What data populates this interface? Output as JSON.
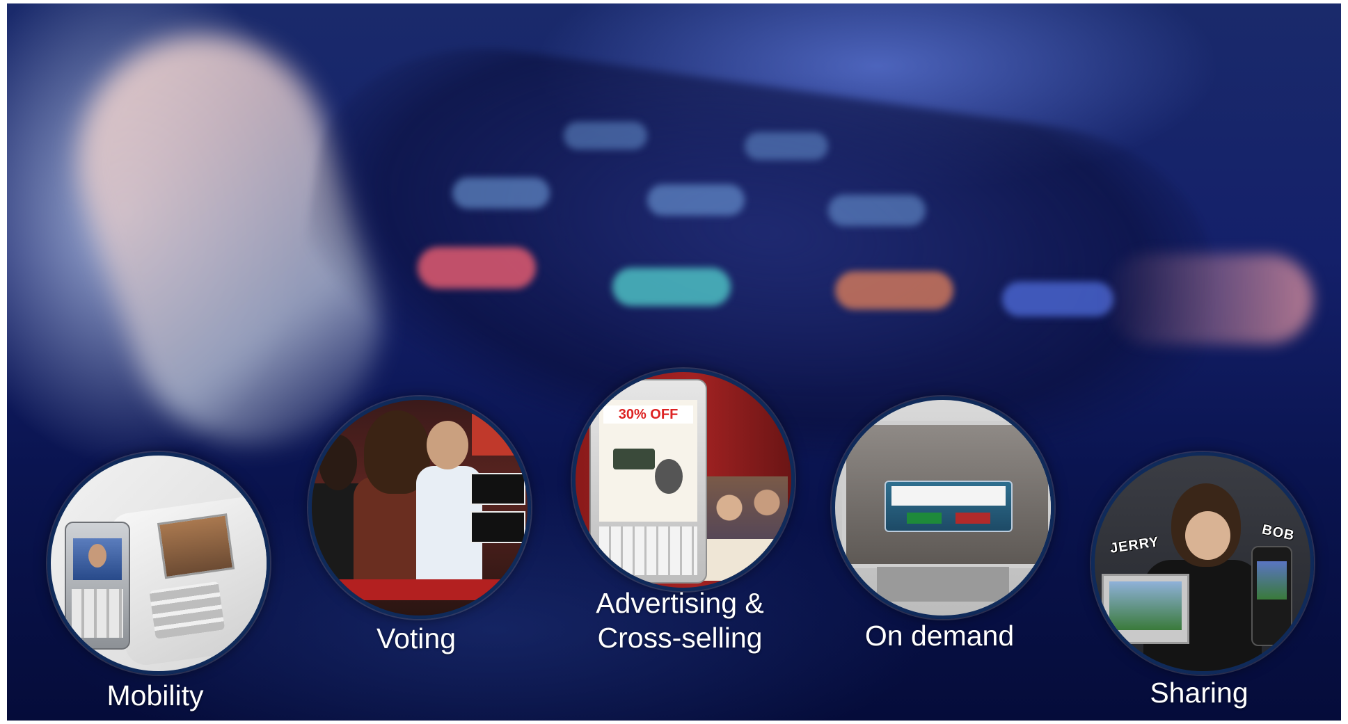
{
  "slide": {
    "features": [
      {
        "id": "mobility",
        "label": "Mobility"
      },
      {
        "id": "voting",
        "label": "Voting"
      },
      {
        "id": "advertising",
        "label_line1": "Advertising &",
        "label_line2": "Cross-selling"
      },
      {
        "id": "on-demand",
        "label": "On demand"
      },
      {
        "id": "sharing",
        "label": "Sharing"
      }
    ],
    "advertising_image": {
      "offer_text": "30% OFF"
    },
    "sharing_image": {
      "tag_left": "JERRY",
      "tag_right": "BOB"
    }
  },
  "colors": {
    "background_deep": "#0a1450",
    "circle_border": "#0f2a5a",
    "label_text": "#ffffff"
  }
}
